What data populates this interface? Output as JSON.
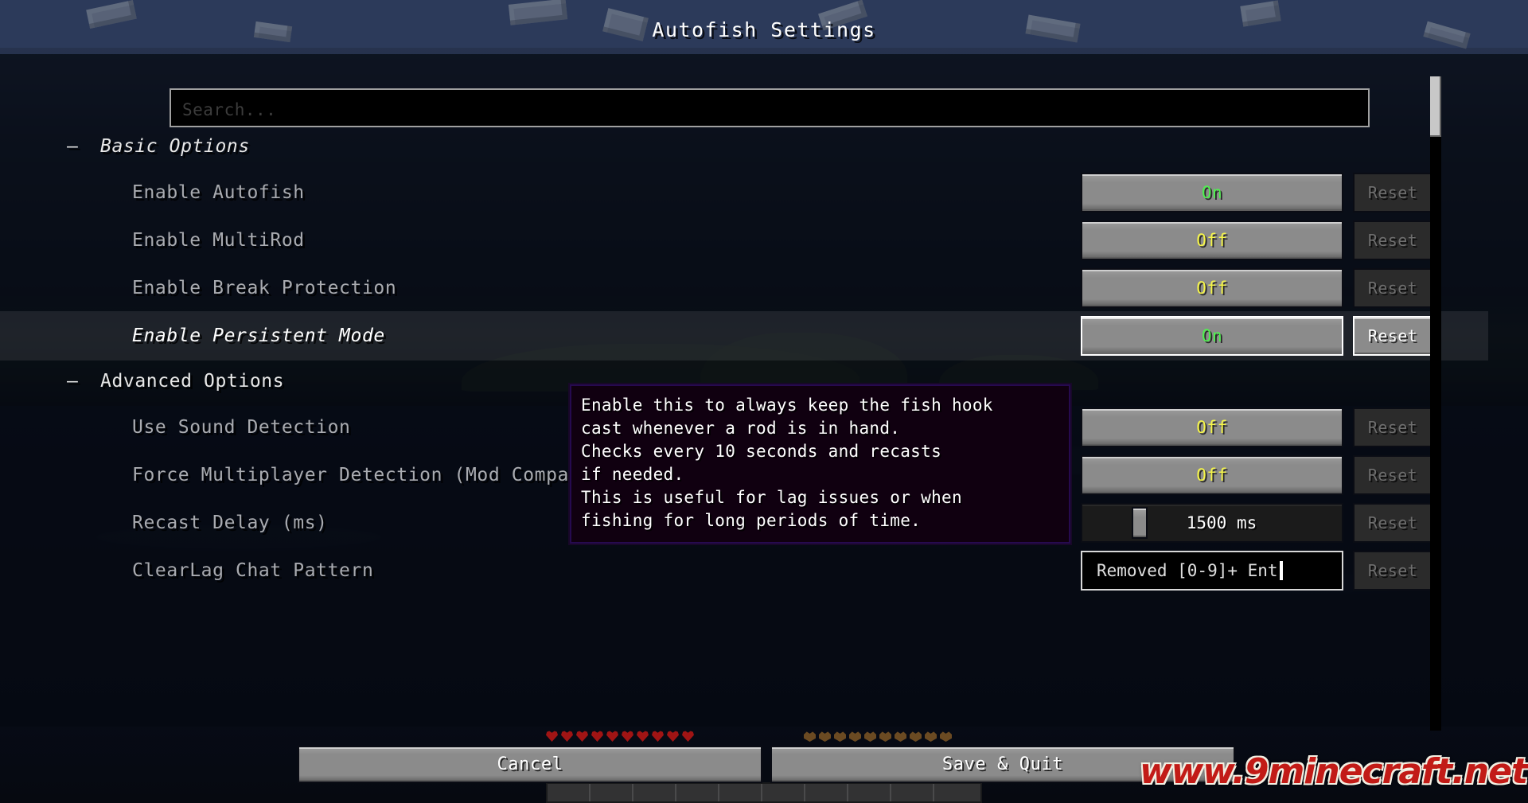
{
  "window": {
    "title": "Autofish Settings"
  },
  "search": {
    "placeholder": "Search...",
    "value": ""
  },
  "categories": [
    {
      "label": "Basic Options",
      "collapse_icon": "–",
      "italic": true
    },
    {
      "label": "Advanced Options",
      "collapse_icon": "–",
      "italic": false
    }
  ],
  "rows": [
    {
      "label": "Enable Autofish",
      "control": "toggle",
      "value": "On",
      "value_state": "on",
      "reset_label": "Reset",
      "reset_enabled": false,
      "hovered": false
    },
    {
      "label": "Enable MultiRod",
      "control": "toggle",
      "value": "Off",
      "value_state": "off",
      "reset_label": "Reset",
      "reset_enabled": false,
      "hovered": false
    },
    {
      "label": "Enable Break Protection",
      "control": "toggle",
      "value": "Off",
      "value_state": "off",
      "reset_label": "Reset",
      "reset_enabled": false,
      "hovered": false
    },
    {
      "label": "Enable Persistent Mode",
      "control": "toggle",
      "value": "On",
      "value_state": "on",
      "reset_label": "Reset",
      "reset_enabled": true,
      "hovered": true
    },
    {
      "label": "Use Sound Detection",
      "control": "toggle",
      "value": "Off",
      "value_state": "off",
      "reset_label": "Reset",
      "reset_enabled": false,
      "hovered": false
    },
    {
      "label": "Force Multiplayer Detection (Mod Compatibility)",
      "control": "toggle",
      "value": "Off",
      "value_state": "off",
      "reset_label": "Reset",
      "reset_enabled": false,
      "hovered": false
    },
    {
      "label": "Recast Delay (ms)",
      "control": "slider",
      "value": "1500 ms",
      "slider_fraction": 0.2,
      "reset_label": "Reset",
      "reset_enabled": false,
      "hovered": false
    },
    {
      "label": "ClearLag Chat Pattern",
      "control": "textfield",
      "value": "Removed [0-9]+ Ent",
      "reset_label": "Reset",
      "reset_enabled": false,
      "hovered": false
    }
  ],
  "tooltip": {
    "lines": [
      "Enable this to always keep the fish hook",
      "cast whenever a rod is in hand.",
      "Checks every 10 seconds and recasts",
      "if needed.",
      "This is useful for lag issues or when",
      "fishing for long periods of time."
    ]
  },
  "footer": {
    "cancel_label": "Cancel",
    "save_label": "Save & Quit"
  },
  "watermark": {
    "text": "www.9minecraft.net"
  },
  "colors": {
    "value_on": "#4ef04e",
    "value_off": "#f5f54a",
    "tooltip_border": "#260a4f",
    "watermark": "#c21b17"
  }
}
